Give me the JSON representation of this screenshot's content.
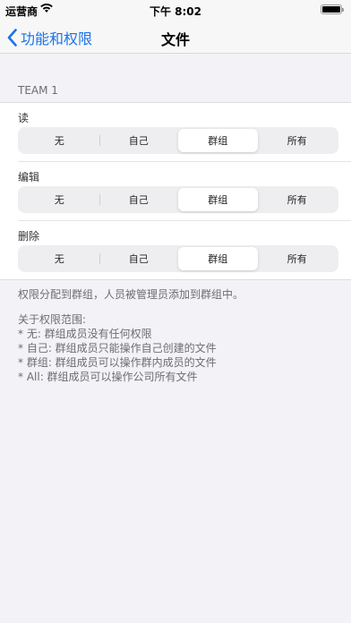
{
  "status": {
    "carrier": "运营商",
    "time": "下午 8:02"
  },
  "nav": {
    "back_label": "功能和权限",
    "title": "文件"
  },
  "section": {
    "header": "TEAM 1"
  },
  "permissions": [
    {
      "label": "读",
      "options": [
        "无",
        "自己",
        "群组",
        "所有"
      ],
      "selected": "群组"
    },
    {
      "label": "编辑",
      "options": [
        "无",
        "自己",
        "群组",
        "所有"
      ],
      "selected": "群组"
    },
    {
      "label": "删除",
      "options": [
        "无",
        "自己",
        "群组",
        "所有"
      ],
      "selected": "群组"
    }
  ],
  "footer": {
    "summary": "权限分配到群组，人员被管理员添加到群组中。",
    "scope_title": "关于权限范围:",
    "scope_lines": [
      "* 无: 群组成员没有任何权限",
      "* 自己: 群组成员只能操作自己创建的文件",
      "* 群组: 群组成员可以操作群内成员的文件",
      "* All: 群组成员可以操作公司所有文件"
    ]
  },
  "colors": {
    "accent": "#1a73e8"
  },
  "icons": {
    "back": "chevron-left-icon",
    "wifi": "wifi-icon",
    "battery": "battery-icon"
  }
}
